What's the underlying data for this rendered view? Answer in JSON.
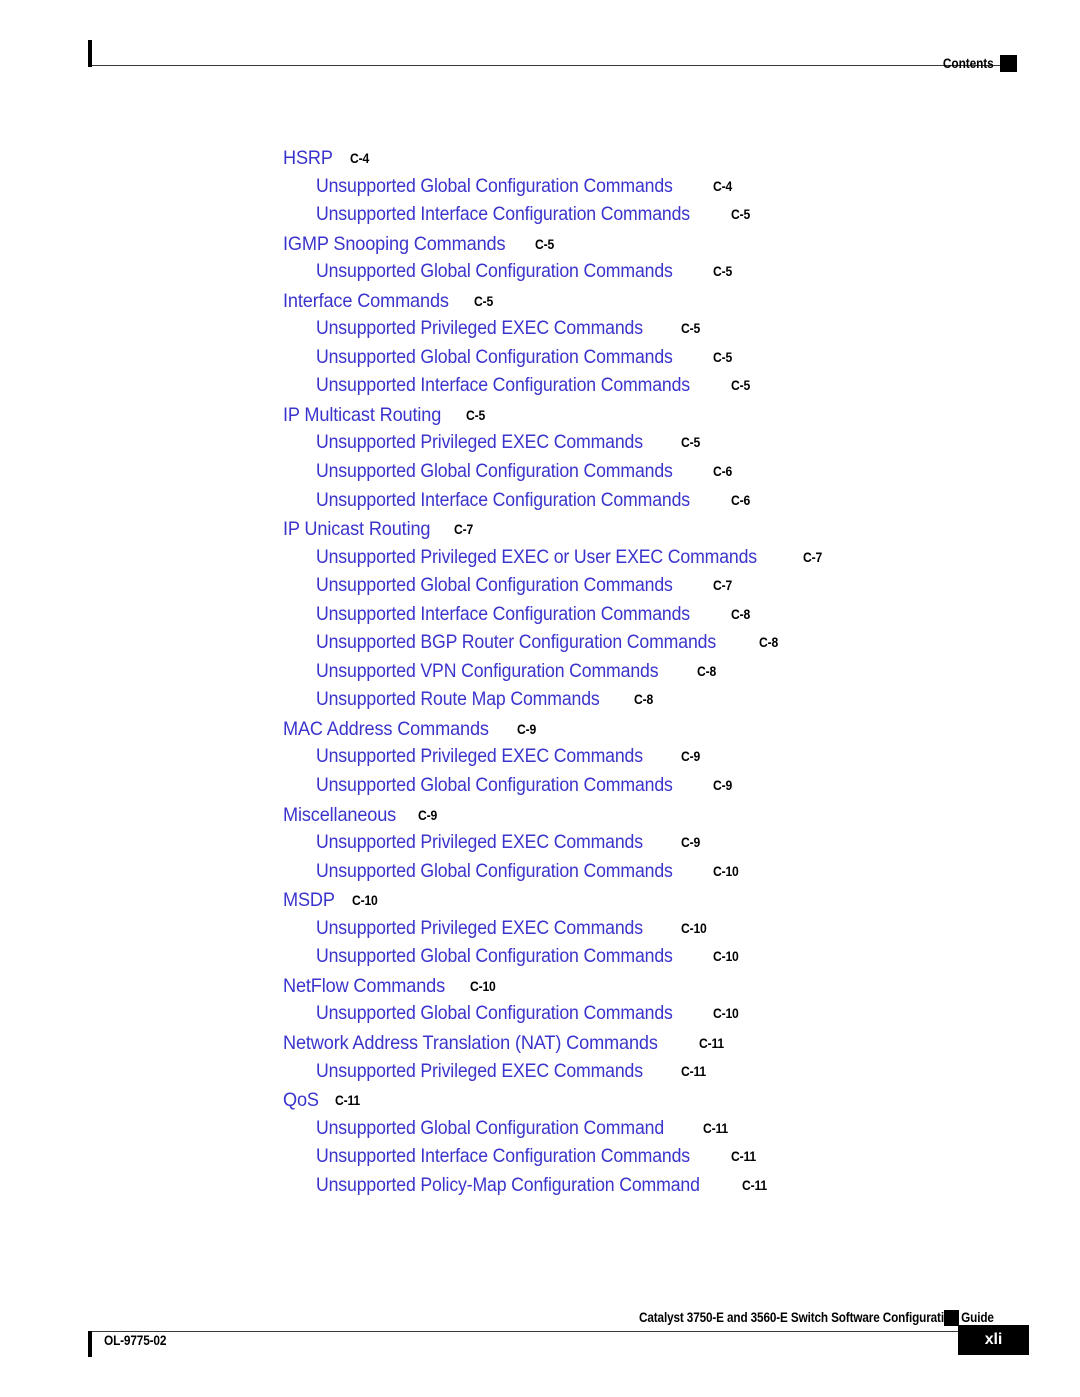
{
  "header": {
    "label": "Contents",
    "marker_icon": "filled-square-marker",
    "tick_icon": "vertical-tick-mark"
  },
  "footer": {
    "guide_title": "Catalyst 3750-E and 3560-E Switch Software Configuration Guide",
    "doc_id": "OL-9775-02",
    "page_number": "xli",
    "marker_icon": "filled-square-marker",
    "tick_icon": "vertical-tick-mark"
  },
  "toc": {
    "entries": [
      {
        "level": 1,
        "title": "HSRP",
        "page": "C-4"
      },
      {
        "level": 2,
        "title": "Unsupported Global Configuration Commands",
        "page": "C-4"
      },
      {
        "level": 2,
        "title": "Unsupported Interface Configuration Commands",
        "page": "C-5"
      },
      {
        "level": 1,
        "title": "IGMP Snooping Commands",
        "page": "C-5"
      },
      {
        "level": 2,
        "title": "Unsupported Global Configuration Commands",
        "page": "C-5"
      },
      {
        "level": 1,
        "title": "Interface Commands",
        "page": "C-5"
      },
      {
        "level": 2,
        "title": "Unsupported Privileged EXEC Commands",
        "page": "C-5"
      },
      {
        "level": 2,
        "title": "Unsupported Global Configuration Commands",
        "page": "C-5"
      },
      {
        "level": 2,
        "title": "Unsupported Interface Configuration Commands",
        "page": "C-5"
      },
      {
        "level": 1,
        "title": "IP Multicast Routing",
        "page": "C-5"
      },
      {
        "level": 2,
        "title": "Unsupported Privileged EXEC Commands",
        "page": "C-5"
      },
      {
        "level": 2,
        "title": "Unsupported Global Configuration Commands",
        "page": "C-6"
      },
      {
        "level": 2,
        "title": "Unsupported Interface Configuration Commands",
        "page": "C-6"
      },
      {
        "level": 1,
        "title": "IP Unicast Routing",
        "page": "C-7"
      },
      {
        "level": 2,
        "title": "Unsupported Privileged EXEC or User EXEC Commands",
        "page": "C-7"
      },
      {
        "level": 2,
        "title": "Unsupported Global Configuration Commands",
        "page": "C-7"
      },
      {
        "level": 2,
        "title": "Unsupported Interface Configuration Commands",
        "page": "C-8"
      },
      {
        "level": 2,
        "title": "Unsupported BGP Router Configuration Commands",
        "page": "C-8"
      },
      {
        "level": 2,
        "title": "Unsupported VPN Configuration Commands",
        "page": "C-8"
      },
      {
        "level": 2,
        "title": "Unsupported Route Map Commands",
        "page": "C-8"
      },
      {
        "level": 1,
        "title": "MAC Address Commands",
        "page": "C-9"
      },
      {
        "level": 2,
        "title": "Unsupported Privileged EXEC Commands",
        "page": "C-9"
      },
      {
        "level": 2,
        "title": "Unsupported Global Configuration Commands",
        "page": "C-9"
      },
      {
        "level": 1,
        "title": "Miscellaneous",
        "page": "C-9"
      },
      {
        "level": 2,
        "title": "Unsupported Privileged EXEC Commands",
        "page": "C-9"
      },
      {
        "level": 2,
        "title": "Unsupported Global Configuration Commands",
        "page": "C-10"
      },
      {
        "level": 1,
        "title": "MSDP",
        "page": "C-10"
      },
      {
        "level": 2,
        "title": "Unsupported Privileged EXEC Commands",
        "page": "C-10"
      },
      {
        "level": 2,
        "title": "Unsupported Global Configuration Commands",
        "page": "C-10"
      },
      {
        "level": 1,
        "title": "NetFlow Commands",
        "page": "C-10"
      },
      {
        "level": 2,
        "title": "Unsupported Global Configuration Commands",
        "page": "C-10"
      },
      {
        "level": 1,
        "title": "Network Address Translation (NAT) Commands",
        "page": "C-11"
      },
      {
        "level": 2,
        "title": "Unsupported Privileged EXEC Commands",
        "page": "C-11"
      },
      {
        "level": 1,
        "title": "QoS",
        "page": "C-11"
      },
      {
        "level": 2,
        "title": "Unsupported Global Configuration Command",
        "page": "C-11"
      },
      {
        "level": 2,
        "title": "Unsupported Interface Configuration Commands",
        "page": "C-11"
      },
      {
        "level": 2,
        "title": "Unsupported Policy-Map Configuration Command",
        "page": "C-11"
      }
    ]
  },
  "colors": {
    "link_blue": "#3b34cc",
    "text_black": "#000000",
    "rule_gray": "#3a3a3a"
  }
}
